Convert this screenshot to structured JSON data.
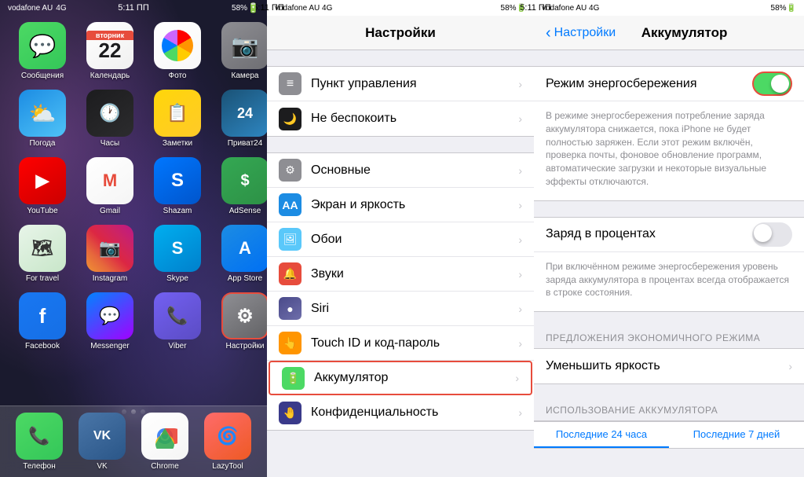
{
  "panel1": {
    "status": {
      "carrier": "vodafone AU",
      "network": "4G",
      "time": "5:11 ПП",
      "battery": "58%"
    },
    "apps": [
      {
        "id": "messages",
        "label": "Сообщения",
        "icon": "💬",
        "class": "app-messages"
      },
      {
        "id": "calendar",
        "label": "Календарь",
        "icon": "22",
        "class": "app-calendar"
      },
      {
        "id": "photos",
        "label": "Фото",
        "icon": "🌸",
        "class": "app-photos"
      },
      {
        "id": "camera",
        "label": "Камера",
        "icon": "📷",
        "class": "app-camera"
      },
      {
        "id": "weather",
        "label": "Погода",
        "icon": "⛅",
        "class": "app-weather"
      },
      {
        "id": "clock",
        "label": "Часы",
        "icon": "🕐",
        "class": "app-clock"
      },
      {
        "id": "notes",
        "label": "Заметки",
        "icon": "📝",
        "class": "app-notes"
      },
      {
        "id": "privat24",
        "label": "Приват24",
        "icon": "24",
        "class": "app-privat"
      },
      {
        "id": "youtube",
        "label": "YouTube",
        "icon": "▶",
        "class": "app-youtube"
      },
      {
        "id": "gmail",
        "label": "Gmail",
        "icon": "M",
        "class": "app-gmail"
      },
      {
        "id": "shazam",
        "label": "Shazam",
        "icon": "S",
        "class": "app-shazam"
      },
      {
        "id": "adsense",
        "label": "AdSense",
        "icon": "$",
        "class": "app-adsense"
      },
      {
        "id": "fortravel",
        "label": "For travel",
        "icon": "🗺",
        "class": "app-maps"
      },
      {
        "id": "instagram",
        "label": "Instagram",
        "icon": "📷",
        "class": "app-instagram"
      },
      {
        "id": "skype",
        "label": "Skype",
        "icon": "S",
        "class": "app-skype"
      },
      {
        "id": "appstore",
        "label": "App Store",
        "icon": "A",
        "class": "app-appstore"
      },
      {
        "id": "facebook",
        "label": "Facebook",
        "icon": "f",
        "class": "app-facebook"
      },
      {
        "id": "messenger",
        "label": "Messenger",
        "icon": "m",
        "class": "app-messenger"
      },
      {
        "id": "viber",
        "label": "Viber",
        "icon": "📞",
        "class": "app-viber"
      },
      {
        "id": "settings",
        "label": "Настройки",
        "icon": "⚙",
        "class": "app-settings"
      }
    ],
    "dock": [
      {
        "id": "phone",
        "label": "Телефон",
        "icon": "📞",
        "class": "app-messages",
        "color": "#4cd964"
      },
      {
        "id": "vk",
        "label": "VK",
        "icon": "VK",
        "class": "app-facebook",
        "color": "#4a76a8"
      },
      {
        "id": "chrome",
        "label": "Chrome",
        "icon": "⬤",
        "class": "app-youtube",
        "color": "#ff0000"
      },
      {
        "id": "lazytool",
        "label": "LazyTool",
        "icon": "🌀",
        "class": "app-viber",
        "color": "#ff6b6b"
      }
    ],
    "calendar_day": "22",
    "calendar_month": "вторник"
  },
  "panel2": {
    "status": {
      "carrier": "vodafone AU",
      "network": "4G",
      "time": "5:11 ПП",
      "battery": "58%"
    },
    "title": "Настройки",
    "rows": [
      {
        "id": "control",
        "label": "Пункт управления",
        "iconBg": "#8e8e93",
        "icon": "≡"
      },
      {
        "id": "donotdisturb",
        "label": "Не беспокоить",
        "iconBg": "#1c1c1e",
        "icon": "🌙"
      },
      {
        "id": "general",
        "label": "Основные",
        "iconBg": "#8e8e93",
        "icon": "⚙"
      },
      {
        "id": "display",
        "label": "Экран и яркость",
        "iconBg": "#1c8ce3",
        "icon": "A"
      },
      {
        "id": "wallpaper",
        "label": "Обои",
        "iconBg": "#5ac8fa",
        "icon": "🖼"
      },
      {
        "id": "sounds",
        "label": "Звуки",
        "iconBg": "#e74c3c",
        "icon": "🔔"
      },
      {
        "id": "siri",
        "label": "Siri",
        "iconBg": "#4a4a8a",
        "icon": "●"
      },
      {
        "id": "touchid",
        "label": "Touch ID и код-пароль",
        "iconBg": "#ff9500",
        "icon": "👆"
      },
      {
        "id": "battery",
        "label": "Аккумулятор",
        "iconBg": "#4cd964",
        "icon": "🔋",
        "highlight": true
      },
      {
        "id": "privacy",
        "label": "Конфиденциальность",
        "iconBg": "#3a3a8a",
        "icon": "🤚"
      }
    ]
  },
  "panel3": {
    "status": {
      "carrier": "vodafone AU",
      "network": "4G",
      "time": "5:11 ПП",
      "battery": "58%"
    },
    "back_label": "Настройки",
    "title": "Аккумулятор",
    "power_save_label": "Режим энергосбережения",
    "power_save_on": true,
    "power_save_desc": "В режиме энергосбережения потребление заряда аккумулятора снижается, пока iPhone не будет полностью заряжен. Если этот режим включён, проверка почты, фоновое обновление программ, автоматические загрузки и некоторые визуальные эффекты отключаются.",
    "charge_percent_label": "Заряд в процентах",
    "charge_percent_on": false,
    "charge_percent_desc": "При включённом режиме энергосбережения уровень заряда аккумулятора в процентах всегда отображается в строке состояния.",
    "economy_section_header": "ПРЕДЛОЖЕНИЯ ЭКОНОМИЧНОГО РЕЖИМА",
    "brightness_label": "Уменьшить яркость",
    "usage_section_header": "ИСПОЛЬЗОВАНИЕ АККУМУЛЯТОРА",
    "tab_24h": "Последние 24 часа",
    "tab_7days": "Последние 7 дней"
  }
}
